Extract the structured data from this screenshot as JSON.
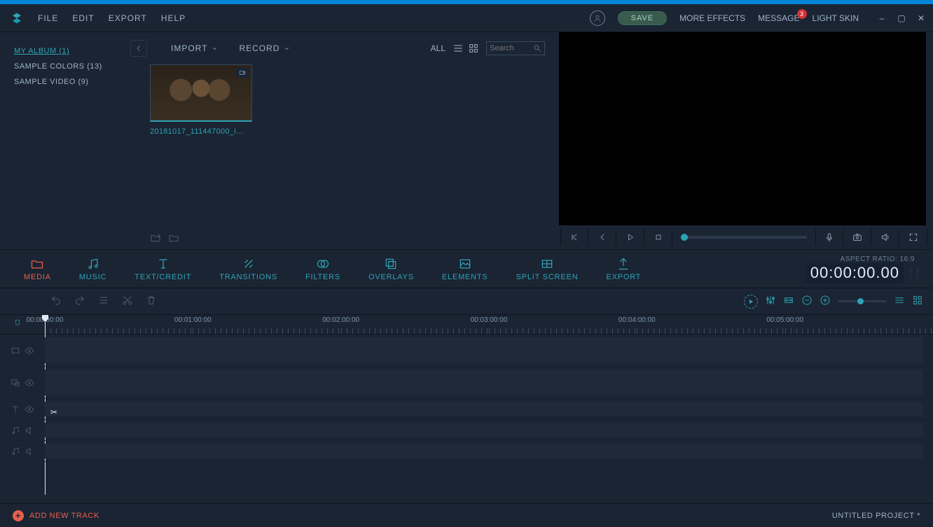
{
  "menubar": {
    "items": [
      "FILE",
      "EDIT",
      "EXPORT",
      "HELP"
    ],
    "save": "SAVE",
    "more_effects": "MORE EFFECTS",
    "message": "MESSAGE",
    "message_badge": "3",
    "light_skin": "LIGHT SKIN"
  },
  "sidebar": {
    "items": [
      {
        "label": "MY ALBUM (1)",
        "active": true
      },
      {
        "label": "SAMPLE COLORS (13)",
        "active": false
      },
      {
        "label": "SAMPLE VIDEO (9)",
        "active": false
      }
    ]
  },
  "library": {
    "import": "IMPORT",
    "record": "RECORD",
    "all": "ALL",
    "search_placeholder": "Search",
    "thumb_label": "20181017_111447000_i..."
  },
  "tabs": {
    "items": [
      {
        "id": "media",
        "label": "MEDIA"
      },
      {
        "id": "music",
        "label": "MUSIC"
      },
      {
        "id": "text",
        "label": "TEXT/CREDIT"
      },
      {
        "id": "transitions",
        "label": "TRANSITIONS"
      },
      {
        "id": "filters",
        "label": "FILTERS"
      },
      {
        "id": "overlays",
        "label": "OVERLAYS"
      },
      {
        "id": "elements",
        "label": "ELEMENTS"
      },
      {
        "id": "split",
        "label": "SPLIT SCREEN"
      },
      {
        "id": "export",
        "label": "EXPORT"
      }
    ],
    "aspect": "ASPECT RATIO: 16:9",
    "timecode": "00:00:00.00"
  },
  "ruler": {
    "ticks": [
      "00:00:00:00",
      "00:01:00:00",
      "00:02:00:00",
      "00:03:00:00",
      "00:04:00:00",
      "00:05:00:00"
    ]
  },
  "footer": {
    "add_track": "ADD NEW TRACK",
    "project": "UNTITLED PROJECT *"
  }
}
